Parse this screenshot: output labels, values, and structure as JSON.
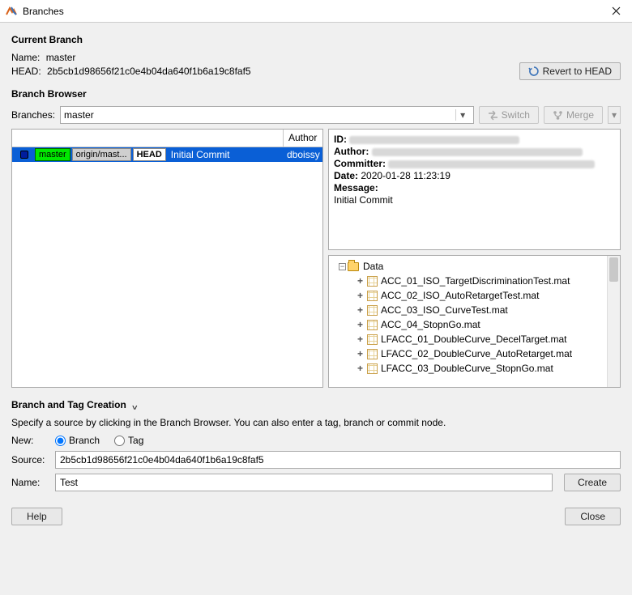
{
  "window": {
    "title": "Branches"
  },
  "current_branch": {
    "header": "Current Branch",
    "name_label": "Name:",
    "name_value": "master",
    "head_label": "HEAD:",
    "head_value": "2b5cb1d98656f21c0e4b04da640f1b6a19c8faf5",
    "revert_button": "Revert to HEAD"
  },
  "browser": {
    "header": "Branch Browser",
    "branches_label": "Branches:",
    "branches_value": "master",
    "switch_button": "Switch",
    "merge_button": "Merge",
    "author_header": "Author",
    "commit": {
      "pills": {
        "master": "master",
        "origin": "origin/mast...",
        "head": "HEAD"
      },
      "message_short": "Initial Commit",
      "author": "dboissy ..."
    }
  },
  "details": {
    "id_label": "ID:",
    "author_label": "Author:",
    "committer_label": "Committer:",
    "date_label": "Date:",
    "date_value": "2020-01-28 11:23:19",
    "message_label": "Message:",
    "message_value": "Initial Commit"
  },
  "tree": {
    "root": "Data",
    "files": [
      "ACC_01_ISO_TargetDiscriminationTest.mat",
      "ACC_02_ISO_AutoRetargetTest.mat",
      "ACC_03_ISO_CurveTest.mat",
      "ACC_04_StopnGo.mat",
      "LFACC_01_DoubleCurve_DecelTarget.mat",
      "LFACC_02_DoubleCurve_AutoRetarget.mat",
      "LFACC_03_DoubleCurve_StopnGo.mat"
    ]
  },
  "create": {
    "header": "Branch and Tag Creation",
    "desc": "Specify a source by clicking in the Branch Browser. You can also enter a tag, branch or commit node.",
    "new_label": "New:",
    "radio_branch": "Branch",
    "radio_tag": "Tag",
    "source_label": "Source:",
    "source_value": "2b5cb1d98656f21c0e4b04da640f1b6a19c8faf5",
    "name_label": "Name:",
    "name_value": "Test",
    "create_button": "Create"
  },
  "buttons": {
    "help": "Help",
    "close": "Close"
  }
}
